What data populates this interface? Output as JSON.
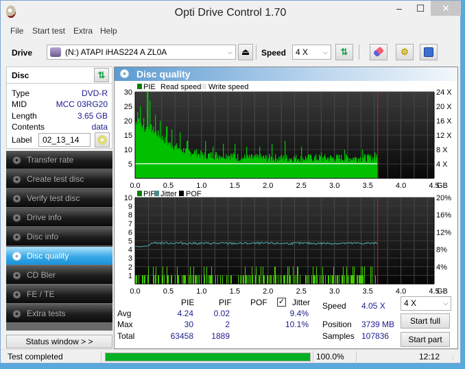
{
  "window": {
    "title": "Opti Drive Control 1.70",
    "minimize": "‒",
    "maximize": "☐",
    "close": "✕"
  },
  "menu": [
    "File",
    "Start test",
    "Extra",
    "Help"
  ],
  "toolbar": {
    "drive_label": "Drive",
    "drive_value": "(N:)   ATAPI iHAS224   A ZL0A",
    "speed_label": "Speed",
    "speed_value": "4 X",
    "icons": [
      "eject-icon",
      "refresh-icon",
      "erase-icon",
      "settings-icon",
      "save-icon"
    ]
  },
  "disc": {
    "header": "Disc",
    "rows": [
      {
        "key": "Type",
        "value": "DVD-R"
      },
      {
        "key": "MID",
        "value": "MCC 03RG20"
      },
      {
        "key": "Length",
        "value": "3.65 GB"
      },
      {
        "key": "Contents",
        "value": "data"
      }
    ],
    "label_key": "Label",
    "label_value": "02_13_14"
  },
  "nav": [
    {
      "label": "Transfer rate",
      "active": false
    },
    {
      "label": "Create test disc",
      "active": false
    },
    {
      "label": "Verify test disc",
      "active": false
    },
    {
      "label": "Drive info",
      "active": false
    },
    {
      "label": "Disc info",
      "active": false
    },
    {
      "label": "Disc quality",
      "active": true
    },
    {
      "label": "CD Bler",
      "active": false
    },
    {
      "label": "FE / TE",
      "active": false
    },
    {
      "label": "Extra tests",
      "active": false
    }
  ],
  "status_window_button": "Status window > >",
  "panel_title": "Disc quality",
  "chart_data": [
    {
      "type": "bar",
      "title": "PIE",
      "legend": [
        "PIE",
        "Read speed",
        "Write speed"
      ],
      "legend_colors": [
        "#008000",
        "#ffffff",
        "#e8e8e8"
      ],
      "x_ticks": [
        "0.0",
        "0.5",
        "1.0",
        "1.5",
        "2.0",
        "2.5",
        "3.0",
        "3.5",
        "4.0",
        "4.5"
      ],
      "x_unit": "GB",
      "xlim": [
        0,
        4.5
      ],
      "y_ticks_left": [
        5,
        10,
        15,
        20,
        25,
        30
      ],
      "ylim": [
        0,
        30
      ],
      "y_ticks_right": [
        "4 X",
        "8 X",
        "12 X",
        "16 X",
        "20 X",
        "24 X"
      ],
      "y_right_lim": [
        0,
        24
      ],
      "end_marker_gb": 3.65,
      "read_speed_x": 4.05,
      "pie_profile": [
        [
          0.0,
          19
        ],
        [
          0.05,
          21
        ],
        [
          0.1,
          18
        ],
        [
          0.15,
          17
        ],
        [
          0.2,
          18
        ],
        [
          0.25,
          17
        ],
        [
          0.3,
          16
        ],
        [
          0.35,
          15
        ],
        [
          0.4,
          14
        ],
        [
          0.45,
          13
        ],
        [
          0.5,
          12
        ],
        [
          0.6,
          11
        ],
        [
          0.7,
          10
        ],
        [
          0.8,
          9
        ],
        [
          0.9,
          9
        ],
        [
          1.0,
          8
        ],
        [
          1.2,
          8
        ],
        [
          1.4,
          8
        ],
        [
          1.6,
          7
        ],
        [
          1.8,
          7
        ],
        [
          2.0,
          7
        ],
        [
          2.2,
          7
        ],
        [
          2.5,
          7
        ],
        [
          3.0,
          7
        ],
        [
          3.5,
          7
        ],
        [
          3.65,
          7
        ]
      ],
      "pie_spikes": [
        [
          0.03,
          23
        ],
        [
          0.07,
          25
        ],
        [
          0.12,
          21
        ],
        [
          0.18,
          30
        ],
        [
          0.22,
          27
        ],
        [
          0.3,
          22
        ],
        [
          0.37,
          20
        ],
        [
          0.47,
          18
        ],
        [
          0.55,
          17
        ],
        [
          0.67,
          16
        ],
        [
          0.78,
          13
        ],
        [
          1.05,
          13
        ],
        [
          1.17,
          11
        ],
        [
          1.32,
          12
        ],
        [
          1.5,
          12
        ],
        [
          1.67,
          11
        ],
        [
          1.87,
          11
        ],
        [
          2.05,
          12
        ],
        [
          2.25,
          13
        ],
        [
          2.5,
          11
        ],
        [
          2.8,
          9
        ],
        [
          3.15,
          10
        ],
        [
          3.42,
          10
        ],
        [
          3.6,
          9
        ]
      ]
    },
    {
      "type": "bar",
      "title": "PIF / Jitter",
      "legend": [
        "PIF",
        "Jitter",
        "POF"
      ],
      "legend_colors": [
        "#008000",
        "#4a8a8a",
        "#000000"
      ],
      "x_ticks": [
        "0.0",
        "0.5",
        "1.0",
        "1.5",
        "2.0",
        "2.5",
        "3.0",
        "3.5",
        "4.0",
        "4.5"
      ],
      "x_unit": "GB",
      "xlim": [
        0,
        4.5
      ],
      "y_ticks_left": [
        1,
        2,
        3,
        4,
        5,
        6,
        7,
        8,
        9,
        10
      ],
      "ylim": [
        0,
        10
      ],
      "y_ticks_right": [
        "4%",
        "8%",
        "12%",
        "16%",
        "20%"
      ],
      "y_right_lim": [
        0,
        20
      ],
      "end_marker_gb": 3.65,
      "jitter_profile_pct": [
        [
          0.0,
          8.8
        ],
        [
          0.05,
          8.6
        ],
        [
          0.2,
          8.8
        ],
        [
          0.25,
          9.5
        ],
        [
          1.0,
          9.4
        ],
        [
          2.0,
          9.4
        ],
        [
          3.0,
          9.4
        ],
        [
          3.65,
          9.4
        ]
      ],
      "pif_max": 2
    }
  ],
  "stats": {
    "headers": [
      "PIE",
      "PIF",
      "POF",
      "Jitter"
    ],
    "jitter_checked": true,
    "rows": [
      {
        "label": "Avg",
        "pie": "4.24",
        "pif": "0.02",
        "pof": "",
        "jitter": "9.4%"
      },
      {
        "label": "Max",
        "pie": "30",
        "pif": "2",
        "pof": "",
        "jitter": "10.1%"
      },
      {
        "label": "Total",
        "pie": "63458",
        "pif": "1889",
        "pof": "",
        "jitter": ""
      }
    ],
    "speed_label": "Speed",
    "speed_value": "4.05 X",
    "position_label": "Position",
    "position_value": "3739 MB",
    "samples_label": "Samples",
    "samples_value": "107836",
    "speed_select": "4 X",
    "start_full": "Start full",
    "start_part": "Start part"
  },
  "statusbar": {
    "text": "Test completed",
    "progress": 100.0,
    "progress_text": "100.0%",
    "time": "12:12"
  }
}
